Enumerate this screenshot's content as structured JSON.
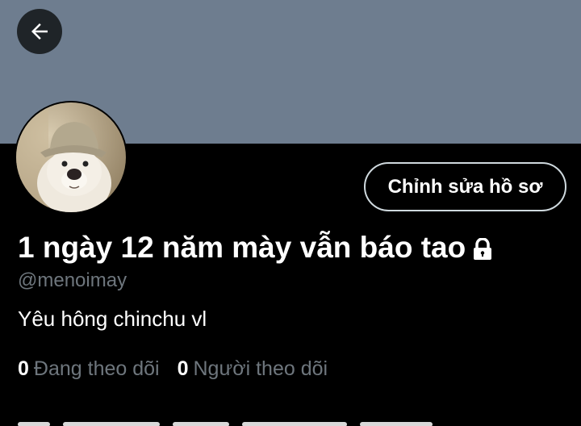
{
  "header": {
    "back_icon": "arrow-left-icon"
  },
  "profile": {
    "display_name": "1 ngày 12 năm mày vẫn báo tao",
    "protected_icon": "lock-icon",
    "handle": "@menoimay",
    "bio": "Yêu hông chinchu vl",
    "edit_button": "Chỉnh sửa hồ sơ",
    "avatar": "dog-avatar",
    "following_count": "0",
    "following_label": "Đang theo dõi",
    "followers_count": "0",
    "followers_label": "Người theo dõi"
  },
  "colors": {
    "banner": "#6e7d8f",
    "background": "#000000",
    "muted": "#6e767d"
  }
}
